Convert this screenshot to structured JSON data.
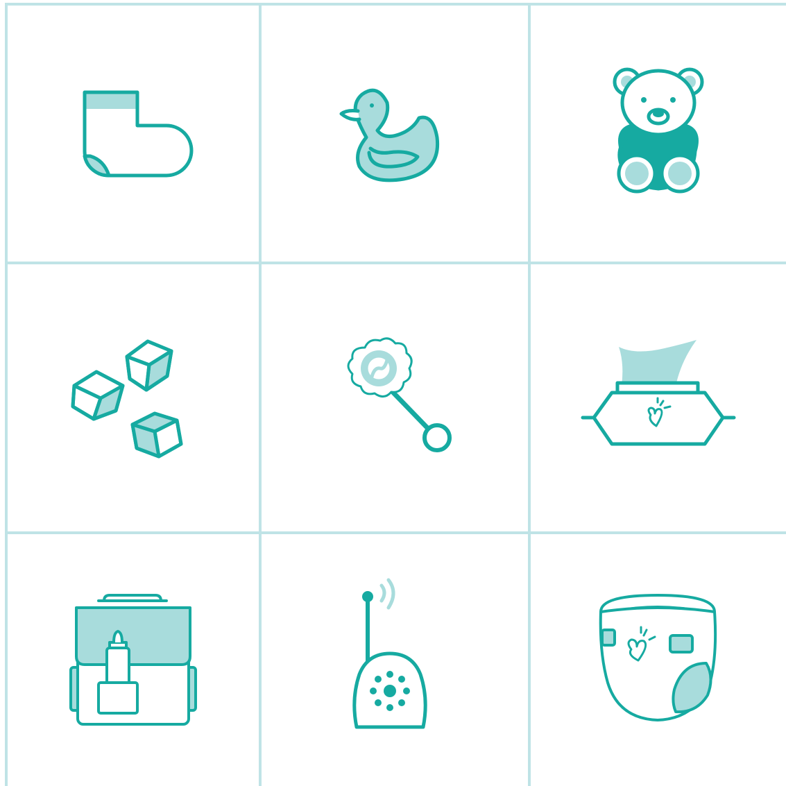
{
  "palette": {
    "stroke": "#16aaa1",
    "fill_light": "#a8dcdc",
    "grid_line": "#bfe3e6",
    "background": "#ffffff"
  },
  "icons": [
    {
      "name": "sock-icon"
    },
    {
      "name": "rubber-duck-icon"
    },
    {
      "name": "teddy-bear-icon"
    },
    {
      "name": "toy-blocks-icon"
    },
    {
      "name": "baby-rattle-icon"
    },
    {
      "name": "baby-wipes-icon"
    },
    {
      "name": "diaper-bag-icon"
    },
    {
      "name": "baby-monitor-icon"
    },
    {
      "name": "diaper-icon"
    }
  ]
}
